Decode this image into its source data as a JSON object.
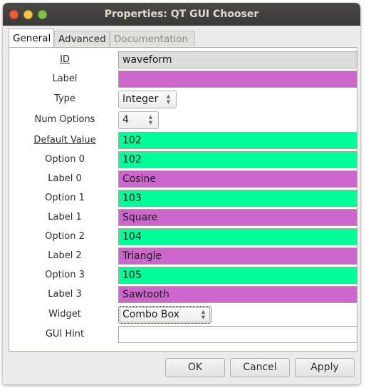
{
  "window": {
    "title": "Properties: QT GUI Chooser"
  },
  "tabs": [
    {
      "label": "General"
    },
    {
      "label": "Advanced"
    },
    {
      "label": "Documentation"
    }
  ],
  "fields": [
    {
      "label": "ID",
      "value": "waveform",
      "kind": "text",
      "color": "#dcdcdc",
      "underline": true
    },
    {
      "label": "Label",
      "value": "",
      "kind": "text",
      "color": "#cc66cc"
    },
    {
      "label": "Type",
      "value": "Integer",
      "kind": "spin"
    },
    {
      "label": "Num Options",
      "value": "4",
      "kind": "spin"
    },
    {
      "label": "Default Value",
      "value": "102",
      "kind": "text",
      "color": "#00ff99",
      "underline": true
    },
    {
      "label": "Option 0",
      "value": "102",
      "kind": "text",
      "color": "#00ff99"
    },
    {
      "label": "Label 0",
      "value": "Cosine",
      "kind": "text",
      "color": "#cc66cc"
    },
    {
      "label": "Option 1",
      "value": "103",
      "kind": "text",
      "color": "#00ff99"
    },
    {
      "label": "Label 1",
      "value": "Square",
      "kind": "text",
      "color": "#cc66cc"
    },
    {
      "label": "Option 2",
      "value": "104",
      "kind": "text",
      "color": "#00ff99"
    },
    {
      "label": "Label 2",
      "value": "Triangle",
      "kind": "text",
      "color": "#cc66cc"
    },
    {
      "label": "Option 3",
      "value": "105",
      "kind": "text",
      "color": "#00ff99"
    },
    {
      "label": "Label 3",
      "value": "Sawtooth",
      "kind": "text",
      "color": "#cc66cc"
    },
    {
      "label": "Widget",
      "value": "Combo Box",
      "kind": "spin"
    },
    {
      "label": "GUI Hint",
      "value": "",
      "kind": "text",
      "color": "#ffffff"
    }
  ],
  "buttons": {
    "ok": "OK",
    "cancel": "Cancel",
    "apply": "Apply"
  },
  "icons": {
    "spin_arrows": "up-down-arrows-icon"
  }
}
